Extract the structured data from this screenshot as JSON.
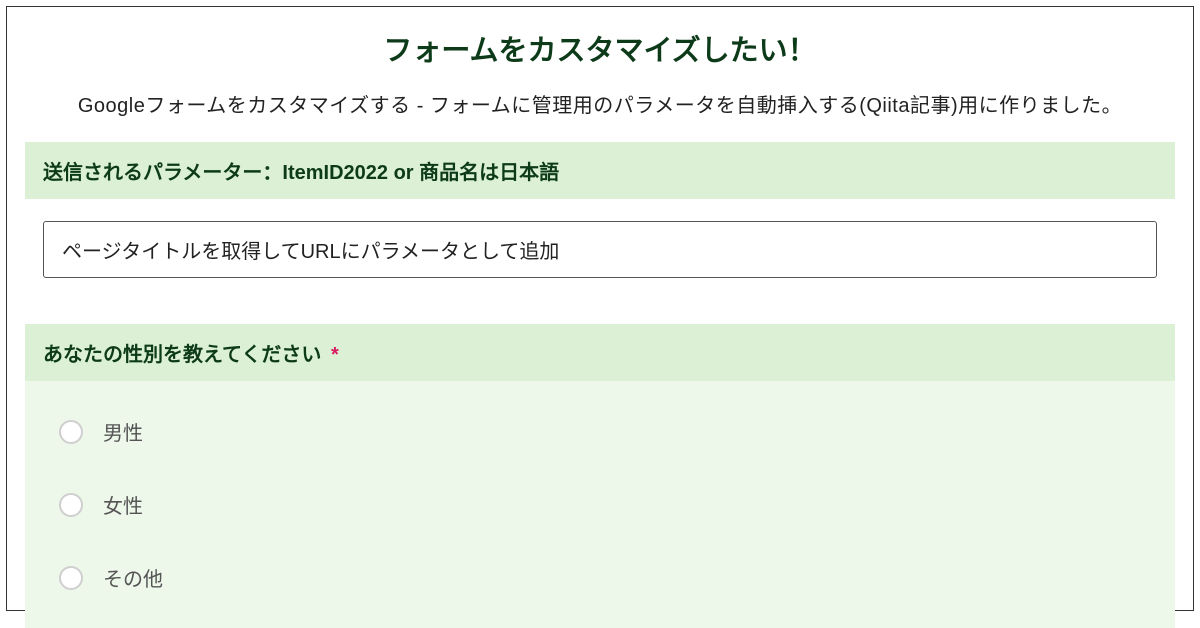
{
  "title": "フォームをカスタマイズしたい！",
  "description": "Googleフォームをカスタマイズする - フォームに管理用のパラメータを自動挿入する(Qiita記事)用に作りました。",
  "sections": {
    "param": {
      "header": "送信されるパラメーター：ItemID2022 or 商品名は日本語",
      "input_value": "ページタイトルを取得してURLにパラメータとして追加"
    },
    "gender": {
      "header": "あなたの性別を教えてください",
      "required_mark": "*",
      "options": [
        {
          "label": "男性"
        },
        {
          "label": "女性"
        },
        {
          "label": "その他"
        }
      ]
    }
  }
}
